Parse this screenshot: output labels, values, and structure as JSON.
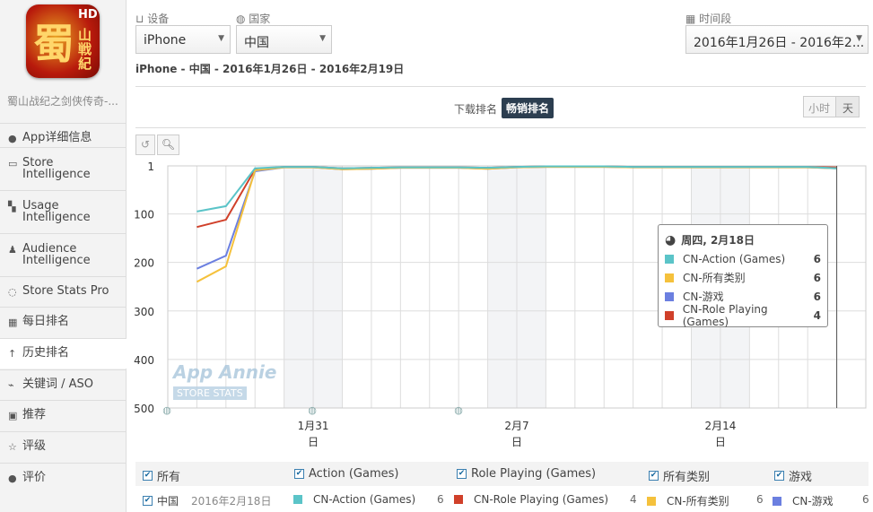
{
  "sidebar": {
    "app_name": "蜀山战纪之剑侠传奇-...",
    "logo_text": "蜀山战纪 HD",
    "items": [
      {
        "label": "App详细信息",
        "icon": "info-icon"
      },
      {
        "label": "Store Intelligence",
        "icon": "store-icon"
      },
      {
        "label": "Usage Intelligence",
        "icon": "usage-icon"
      },
      {
        "label": "Audience Intelligence",
        "icon": "person-icon"
      },
      {
        "label": "Store Stats Pro",
        "icon": "circle-icon"
      },
      {
        "label": "每日排名",
        "icon": "calendar-icon"
      },
      {
        "label": "历史排名",
        "icon": "arrow-up-icon",
        "active": true
      },
      {
        "label": "关键词 / ASO",
        "icon": "keyword-icon"
      },
      {
        "label": "推荐",
        "icon": "feature-icon"
      },
      {
        "label": "评级",
        "icon": "star-icon"
      },
      {
        "label": "评价",
        "icon": "comment-icon"
      }
    ]
  },
  "filters": {
    "device_label": "设备",
    "device_value": "iPhone",
    "country_label": "国家",
    "country_value": "中国",
    "period_label": "时间段",
    "period_value": "2016年1月26日 - 2016年2..."
  },
  "subtitle": "iPhone - 中国 - 2016年1月26日 - 2016年2月19日",
  "rank_toggle": {
    "download": "下载排名",
    "grossing": "畅销排名",
    "active": "grossing"
  },
  "granularity": {
    "hour": "小时",
    "day": "天",
    "active": "day"
  },
  "watermark": {
    "line1": "App Annie",
    "line2": "STORE STATS"
  },
  "colors": {
    "action": "#5bc4c8",
    "all": "#f5c13c",
    "games": "#6b7fe0",
    "rpg": "#d0402a",
    "active_btn": "#2c3e50"
  },
  "chart_data": {
    "type": "line",
    "y_reversed": true,
    "ylim": [
      1,
      500
    ],
    "yticks": [
      "1",
      "100",
      "200",
      "300",
      "400",
      "500"
    ],
    "xlim": [
      "2016-01-26",
      "2016-02-19"
    ],
    "xticks": [
      {
        "date": "2016-01-31",
        "label": "1月31",
        "sub": "日"
      },
      {
        "date": "2016-02-07",
        "label": "2月7",
        "sub": "日"
      },
      {
        "date": "2016-02-14",
        "label": "2月14",
        "sub": "日"
      }
    ],
    "weekends": [
      [
        "2016-01-30",
        "2016-02-01"
      ],
      [
        "2016-02-06",
        "2016-02-08"
      ],
      [
        "2016-02-13",
        "2016-02-15"
      ]
    ],
    "grid": true,
    "x_start": "2016-01-27",
    "series": [
      {
        "name": "CN-Action (Games)",
        "color": "#5bc4c8",
        "values": [
          95,
          84,
          6,
          3,
          3,
          6,
          5,
          4,
          4,
          4,
          5,
          3,
          2,
          2,
          2,
          3,
          3,
          3,
          3,
          3,
          3,
          3,
          6
        ]
      },
      {
        "name": "CN-所有类别",
        "color": "#f5c13c",
        "values": [
          240,
          208,
          10,
          4,
          4,
          8,
          7,
          5,
          5,
          5,
          7,
          4,
          3,
          3,
          3,
          4,
          4,
          4,
          4,
          4,
          4,
          4,
          6
        ]
      },
      {
        "name": "CN-游戏",
        "color": "#6b7fe0",
        "values": [
          213,
          186,
          12,
          4,
          4,
          8,
          7,
          5,
          5,
          5,
          7,
          4,
          3,
          3,
          3,
          4,
          4,
          4,
          4,
          4,
          4,
          4,
          6
        ]
      },
      {
        "name": "CN-Role Playing (Games)",
        "color": "#d0402a",
        "values": [
          127,
          112,
          8,
          3,
          3,
          6,
          5,
          4,
          4,
          4,
          5,
          3,
          2,
          2,
          2,
          3,
          3,
          3,
          3,
          3,
          3,
          3,
          4
        ]
      }
    ],
    "tooltip": {
      "icon": "globe-icon",
      "title": "周四, 2月18日",
      "rows": [
        {
          "name": "CN-Action (Games)",
          "value": "6",
          "color": "#5bc4c8"
        },
        {
          "name": "CN-所有类别",
          "value": "6",
          "color": "#f5c13c"
        },
        {
          "name": "CN-游戏",
          "value": "6",
          "color": "#6b7fe0"
        },
        {
          "name": "CN-Role Playing (Games)",
          "value": "4",
          "color": "#d0402a"
        }
      ]
    }
  },
  "legend": {
    "items": [
      "所有",
      "Action (Games)",
      "Role Playing (Games)",
      "所有类别",
      "游戏"
    ]
  },
  "detail_row": {
    "country": "中国",
    "date": "2016年2月18日",
    "items": [
      {
        "name": "CN-Action (Games)",
        "value": "6",
        "color": "#5bc4c8"
      },
      {
        "name": "CN-Role Playing (Games)",
        "value": "4",
        "color": "#d0402a"
      },
      {
        "name": "CN-所有类别",
        "value": "6",
        "color": "#f5c13c"
      },
      {
        "name": "CN-游戏",
        "value": "6",
        "color": "#6b7fe0"
      }
    ]
  }
}
